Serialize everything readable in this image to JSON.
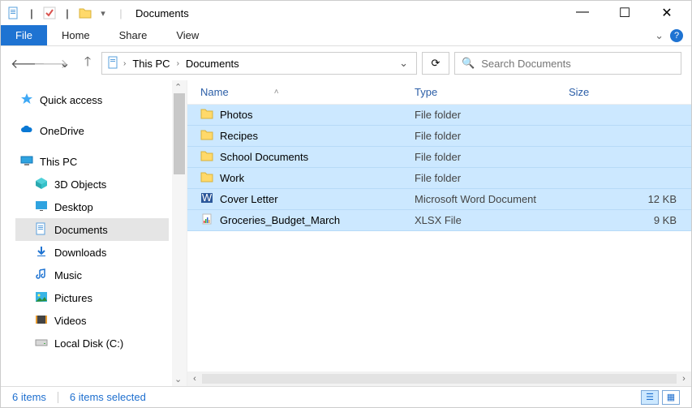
{
  "window": {
    "title": "Documents",
    "sep": "|"
  },
  "ribbon": {
    "file": "File",
    "tabs": [
      "Home",
      "Share",
      "View"
    ],
    "help": "?"
  },
  "nav": {
    "back": "🡐",
    "forward": "🡒",
    "recent": "⌄",
    "up": "🡑"
  },
  "address": {
    "crumbs": [
      "This PC",
      "Documents"
    ],
    "chev": "›",
    "dropdown": "⌄",
    "refresh": "⟳"
  },
  "search": {
    "icon": "🔍",
    "placeholder": "Search Documents"
  },
  "sidebar": [
    {
      "type": "item",
      "icon": "star",
      "label": "Quick access"
    },
    {
      "type": "spacer"
    },
    {
      "type": "item",
      "icon": "onedrive",
      "label": "OneDrive"
    },
    {
      "type": "spacer"
    },
    {
      "type": "item",
      "icon": "pc",
      "label": "This PC"
    },
    {
      "type": "sub",
      "icon": "cube",
      "label": "3D Objects"
    },
    {
      "type": "sub",
      "icon": "desktop",
      "label": "Desktop"
    },
    {
      "type": "sub",
      "icon": "doc",
      "label": "Documents",
      "sel": true
    },
    {
      "type": "sub",
      "icon": "down",
      "label": "Downloads"
    },
    {
      "type": "sub",
      "icon": "music",
      "label": "Music"
    },
    {
      "type": "sub",
      "icon": "pic",
      "label": "Pictures"
    },
    {
      "type": "sub",
      "icon": "video",
      "label": "Videos"
    },
    {
      "type": "sub",
      "icon": "disk",
      "label": "Local Disk (C:)"
    }
  ],
  "columns": {
    "name": "Name",
    "type": "Type",
    "size": "Size",
    "sort": "˄"
  },
  "files": [
    {
      "icon": "folder",
      "name": "Photos",
      "type": "File folder",
      "size": ""
    },
    {
      "icon": "folder",
      "name": "Recipes",
      "type": "File folder",
      "size": ""
    },
    {
      "icon": "folder",
      "name": "School Documents",
      "type": "File folder",
      "size": ""
    },
    {
      "icon": "folder",
      "name": "Work",
      "type": "File folder",
      "size": ""
    },
    {
      "icon": "word",
      "name": "Cover Letter",
      "type": "Microsoft Word Document",
      "size": "12 KB"
    },
    {
      "icon": "xlsx",
      "name": "Groceries_Budget_March",
      "type": "XLSX File",
      "size": "9 KB"
    }
  ],
  "status": {
    "count": "6 items",
    "selected": "6 items selected"
  }
}
